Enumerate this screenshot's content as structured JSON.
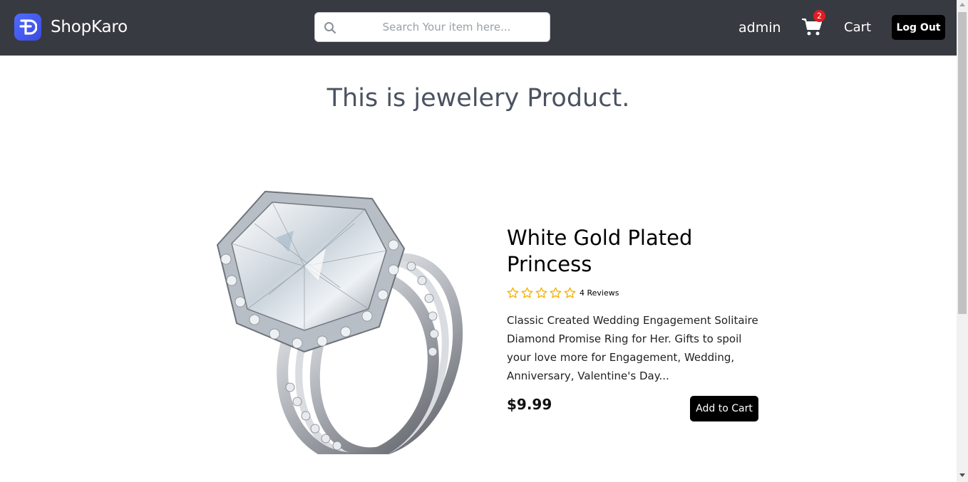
{
  "nav": {
    "brand": "ShopKaro",
    "search_placeholder": "Search Your item here...",
    "user": "admin",
    "cart_count": "2",
    "cart_label": "Cart",
    "logout_label": "Log Out"
  },
  "page": {
    "heading": "This is jewelery Product."
  },
  "product": {
    "title": "White Gold Plated Princess",
    "rating": 0,
    "rating_max": 5,
    "reviews": "4 Reviews",
    "description": "Classic Created Wedding Engagement Solitaire Diamond Promise Ring for Her. Gifts to spoil your love more for Engagement, Wedding, Anniversary, Valentine's Day...",
    "price": "$9.99",
    "add_to_cart_label": "Add to Cart"
  },
  "colors": {
    "navbar": "#383a41",
    "star": "#f5b301",
    "badge": "#e31b23",
    "button": "#000000"
  },
  "icons": [
    "logo-icon",
    "search-icon",
    "cart-icon",
    "star-outline-icon"
  ]
}
